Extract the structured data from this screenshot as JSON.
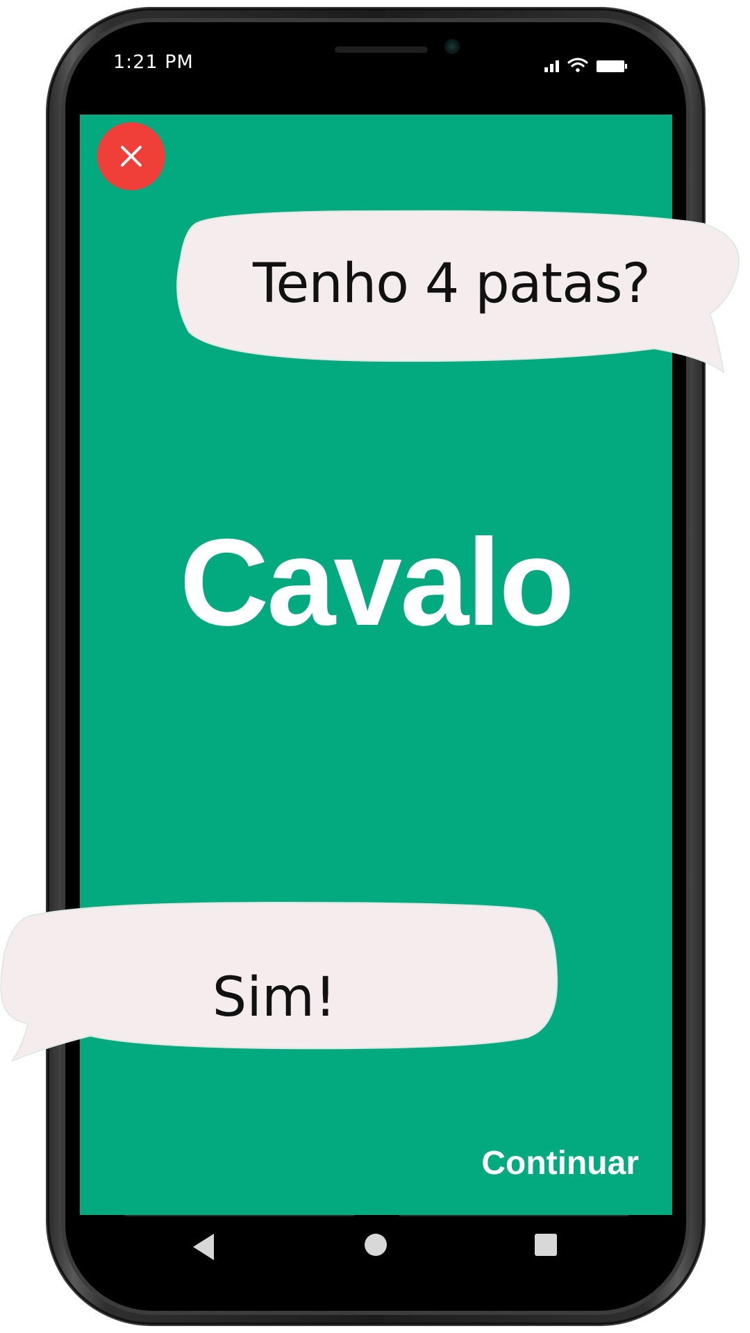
{
  "status_bar": {
    "time": "1:21 PM"
  },
  "dialog": {
    "question": "Tenho 4 patas?",
    "answer": "Sim!"
  },
  "card": {
    "word": "Cavalo"
  },
  "actions": {
    "continue_label": "Continuar",
    "close_icon": "close-icon"
  },
  "colors": {
    "screen_background": "#03aa7f",
    "close_button": "#ef3f38",
    "bubble_fill": "#f5ecee",
    "text_light": "#ffffff"
  }
}
